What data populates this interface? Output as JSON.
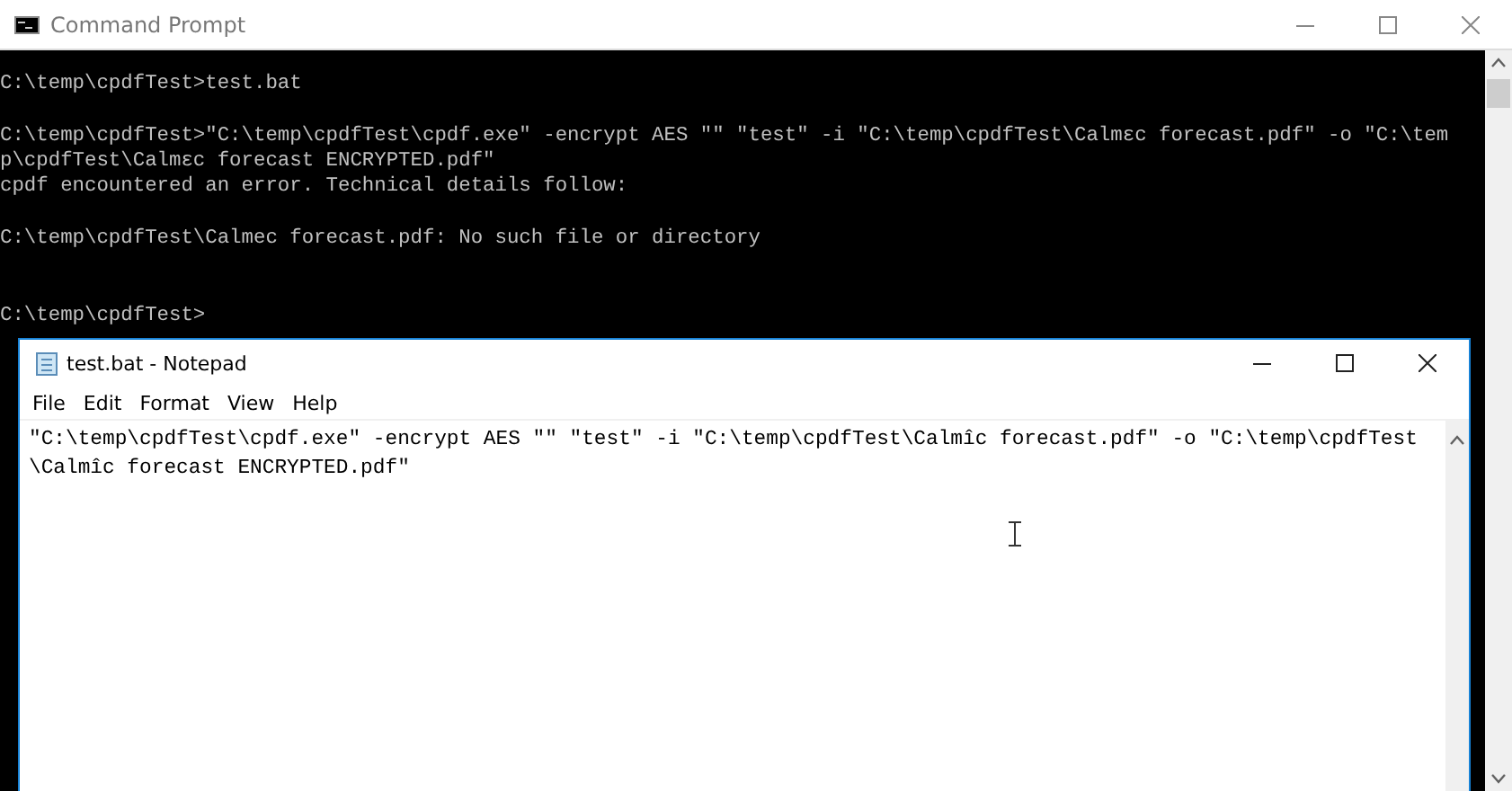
{
  "console_window": {
    "title": "Command Prompt",
    "blocks": [
      {
        "extra_space": false,
        "lines": [
          "C:\\temp\\cpdfTest>test.bat"
        ]
      },
      {
        "extra_space": false,
        "lines": [
          "C:\\temp\\cpdfTest>\"C:\\temp\\cpdfTest\\cpdf.exe\" -encrypt AES \"\" \"test\" -i \"C:\\temp\\cpdfTest\\Calmεc forecast.pdf\" -o \"C:\\tem",
          "p\\cpdfTest\\Calmεc forecast ENCRYPTED.pdf\"",
          "cpdf encountered an error. Technical details follow:"
        ]
      },
      {
        "extra_space": false,
        "lines": [
          "C:\\temp\\cpdfTest\\Calmec forecast.pdf: No such file or directory"
        ]
      },
      {
        "extra_space": true,
        "lines": [
          "C:\\temp\\cpdfTest>"
        ]
      }
    ]
  },
  "notepad_window": {
    "title": "test.bat - Notepad",
    "menu": [
      "File",
      "Edit",
      "Format",
      "View",
      "Help"
    ],
    "lines": [
      "\"C:\\temp\\cpdfTest\\cpdf.exe\" -encrypt AES \"\" \"test\" -i \"C:\\temp\\cpdfTest\\Calmîc forecast.pdf\" -o \"C:\\temp\\cpdfTest",
      "\\Calmîc forecast ENCRYPTED.pdf\""
    ]
  }
}
